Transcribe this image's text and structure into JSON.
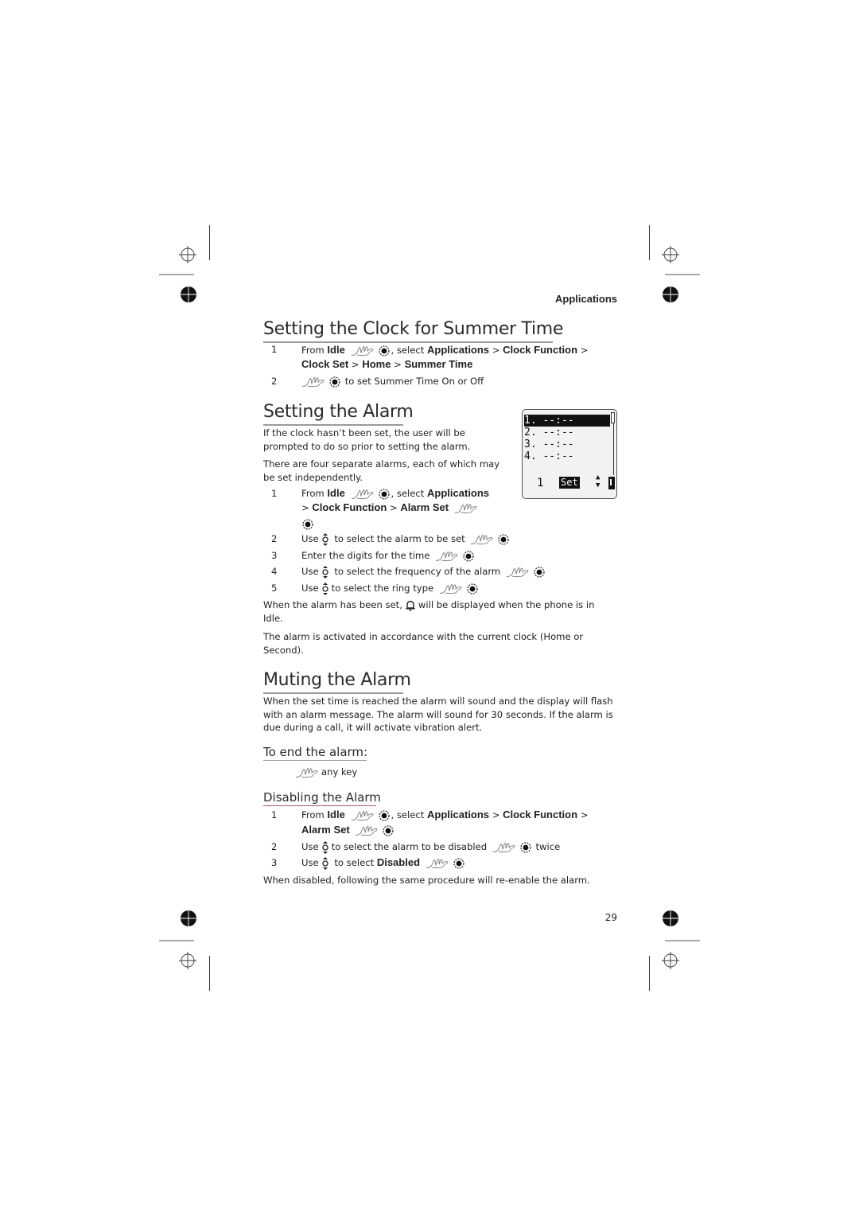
{
  "running_head": "Applications",
  "page_number": "29",
  "sections": {
    "summer_time": {
      "title": "Setting the Clock for Summer Time",
      "steps": [
        {
          "num": "1",
          "from": "From ",
          "idle": "Idle",
          "select": ", select ",
          "path1": "Applications",
          "sep": " > ",
          "path2": "Clock Function",
          "trail": " >",
          "line2a": "Clock Set",
          "line2b": "Home",
          "line2c": "Summer Time"
        },
        {
          "num": "2",
          "text": "to set Summer Time On or Off"
        }
      ]
    },
    "setting_alarm": {
      "title": "Setting the Alarm",
      "para1": "If the clock hasn’t been set, the user will be prompted to do so prior to setting the alarm.",
      "para2": "There are four separate alarms, each of which may be set independently.",
      "step1": {
        "num": "1",
        "from": "From ",
        "idle": "Idle",
        "select": ", select ",
        "path1": "Applications",
        "gt": "> ",
        "path2": "Clock Function",
        "sep": " > ",
        "path3": "Alarm Set"
      },
      "steps": [
        {
          "num": "2",
          "pre": "Use",
          "text": "to select the alarm to be set"
        },
        {
          "num": "3",
          "pre": "",
          "text": "Enter the digits for the time"
        },
        {
          "num": "4",
          "pre": "Use",
          "text": "to select the frequency of the alarm"
        },
        {
          "num": "5",
          "pre": "Use",
          "text": "to select the ring type"
        }
      ],
      "para3a": "When the alarm has been set,",
      "para3b": "will be displayed when the phone is in Idle.",
      "para4": "The alarm is activated in accordance with the current clock (Home or Second).",
      "screen": {
        "rows": [
          "1. --:--",
          "2. --:--",
          "3. --:--",
          "4. --:--"
        ],
        "selected_index": 0,
        "left_soft": "1",
        "center_soft": "Set",
        "up_arrow": "▲",
        "down_arrow": "▼"
      }
    },
    "muting_alarm": {
      "title": "Muting the Alarm",
      "para": "When the set time is reached the alarm will sound and the display will flash with an alarm message. The alarm will sound for 30 seconds. If the alarm is due during a call, it will activate vibration alert.",
      "end_title": "To end the alarm:",
      "end_text": "any key"
    },
    "disabling_alarm": {
      "title": "Disabling the Alarm",
      "step1": {
        "num": "1",
        "from": "From ",
        "idle": "Idle",
        "select": ", select ",
        "path1": "Applications",
        "sep": " > ",
        "path2": "Clock Function",
        "trail": " >",
        "path3": "Alarm Set"
      },
      "step2": {
        "num": "2",
        "pre": "Use",
        "text": "to select the alarm to be disabled",
        "post": "twice"
      },
      "step3": {
        "num": "3",
        "pre": "Use",
        "text": "to select ",
        "bold": "Disabled"
      },
      "footer": "When disabled, following the same procedure will re-enable the alarm."
    }
  }
}
